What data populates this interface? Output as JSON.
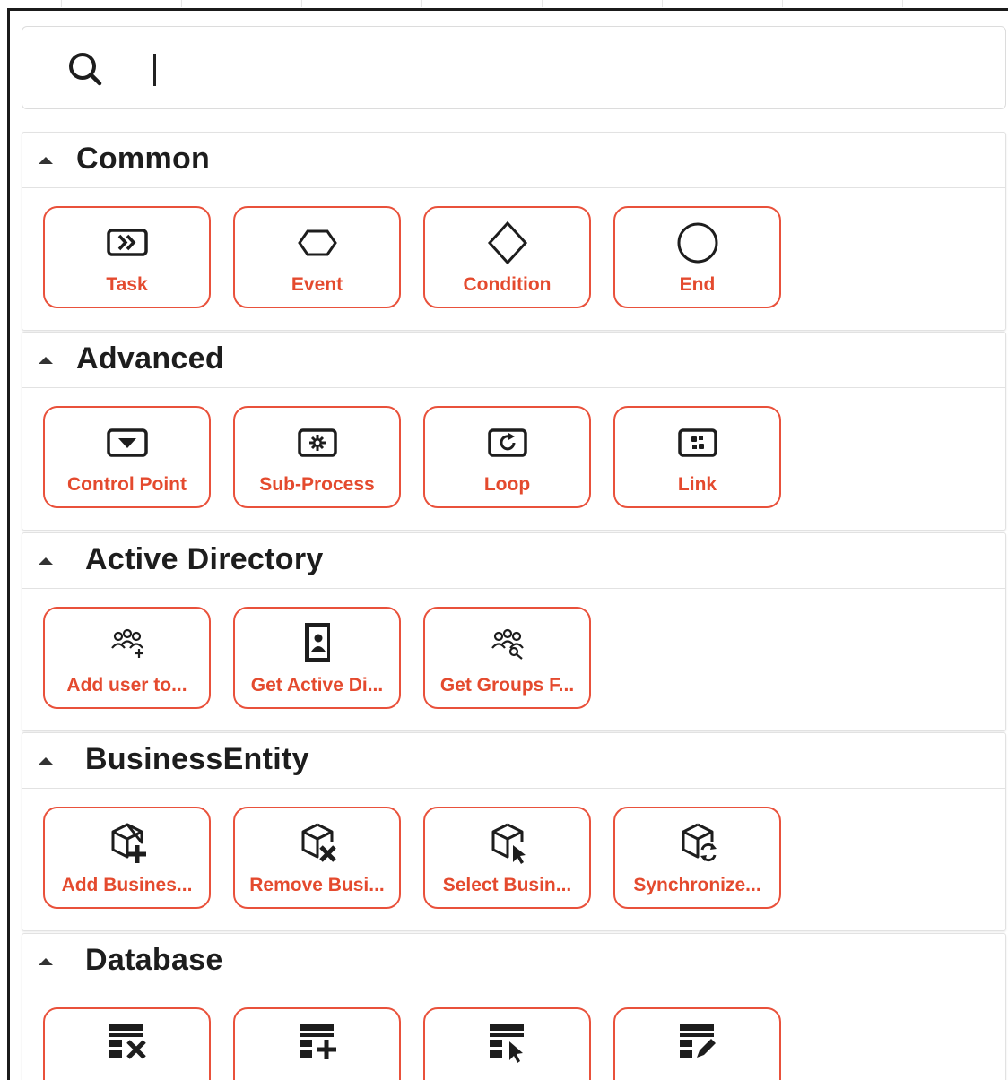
{
  "search": {
    "value": "",
    "placeholder": ""
  },
  "sections": [
    {
      "title": "Common",
      "tiles": [
        {
          "label": "Task",
          "icon": "task-icon"
        },
        {
          "label": "Event",
          "icon": "event-hexagon-icon"
        },
        {
          "label": "Condition",
          "icon": "condition-diamond-icon"
        },
        {
          "label": "End",
          "icon": "end-circle-icon"
        }
      ]
    },
    {
      "title": "Advanced",
      "tiles": [
        {
          "label": "Control Point",
          "icon": "control-point-icon"
        },
        {
          "label": "Sub-Process",
          "icon": "sub-process-icon"
        },
        {
          "label": "Loop",
          "icon": "loop-icon"
        },
        {
          "label": "Link",
          "icon": "link-icon"
        }
      ]
    },
    {
      "title": "Active Directory",
      "tiles": [
        {
          "label": "Add user to...",
          "icon": "add-user-group-icon"
        },
        {
          "label": "Get Active Di...",
          "icon": "directory-icon"
        },
        {
          "label": "Get Groups F...",
          "icon": "search-group-icon"
        }
      ]
    },
    {
      "title": "BusinessEntity",
      "tiles": [
        {
          "label": "Add Busines...",
          "icon": "cube-add-icon"
        },
        {
          "label": "Remove Busi...",
          "icon": "cube-remove-icon"
        },
        {
          "label": "Select Busin...",
          "icon": "cube-select-icon"
        },
        {
          "label": "Synchronize...",
          "icon": "cube-sync-icon"
        }
      ]
    },
    {
      "title": "Database",
      "tiles": [
        {
          "label": "",
          "icon": "table-delete-icon"
        },
        {
          "label": "",
          "icon": "table-insert-icon"
        },
        {
          "label": "",
          "icon": "table-select-icon"
        },
        {
          "label": "",
          "icon": "table-update-icon"
        }
      ]
    }
  ],
  "colors": {
    "accent": "#e44a2e",
    "tile_border": "#e9513b",
    "text": "#1d1d1d"
  }
}
